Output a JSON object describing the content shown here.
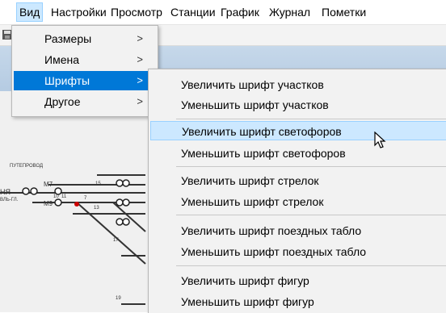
{
  "menubar": {
    "items": [
      {
        "label": "Вид",
        "active": true
      },
      {
        "label": "Настройки"
      },
      {
        "label": "Просмотр"
      },
      {
        "label": "Станции"
      },
      {
        "label": "График"
      },
      {
        "label": "Журнал"
      },
      {
        "label": "Пометки"
      }
    ]
  },
  "view_menu": {
    "items": [
      {
        "label": "Размеры",
        "arrow": ">"
      },
      {
        "label": "Имена",
        "arrow": ">"
      },
      {
        "label": "Шрифты",
        "arrow": ">"
      },
      {
        "label": "Другое",
        "arrow": ">"
      }
    ]
  },
  "fonts_menu": {
    "items": [
      {
        "label": "Увеличить шрифт участков"
      },
      {
        "label": "Уменьшить шрифт участков"
      },
      {
        "label": "Увеличить шрифт светофоров"
      },
      {
        "label": "Уменьшить шрифт светофоров"
      },
      {
        "label": "Увеличить шрифт стрелок"
      },
      {
        "label": "Уменьшить шрифт стрелок"
      },
      {
        "label": "Увеличить шрифт поездных табло"
      },
      {
        "label": "Уменьшить шрифт поездных табло"
      },
      {
        "label": "Увеличить шрифт фигур"
      },
      {
        "label": "Уменьшить шрифт фигур"
      }
    ]
  },
  "background_drawing": {
    "labels": [
      "ПУТЕПРОВОД",
      "НЯ",
      "М7",
      "М9",
      "ВЛЬ-ГЛ.",
      "15",
      "7",
      "10",
      "11",
      "13",
      "17",
      "19"
    ]
  },
  "colors": {
    "highlight": "#0078d7",
    "hover": "#cce8ff",
    "menu_bg": "#f2f2f2",
    "accent_red": "#cc0000"
  }
}
